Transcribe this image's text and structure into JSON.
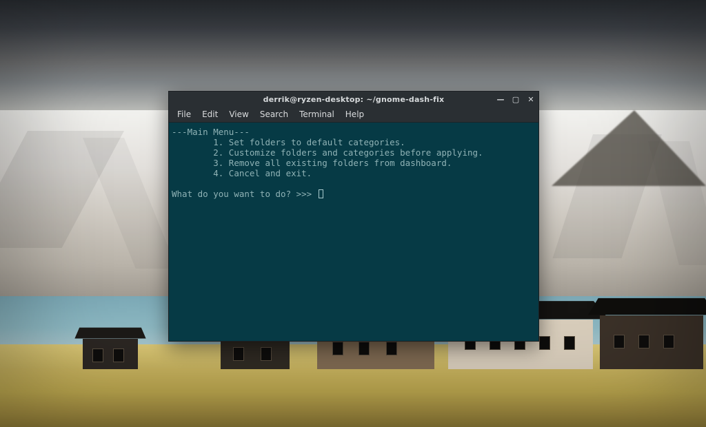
{
  "window": {
    "title": "derrik@ryzen-desktop: ~/gnome-dash-fix",
    "controls": {
      "minimize": "—",
      "maximize": "▢",
      "close": "✕"
    }
  },
  "menubar": {
    "items": [
      "File",
      "Edit",
      "View",
      "Search",
      "Terminal",
      "Help"
    ]
  },
  "terminal": {
    "menu_header": "---Main Menu---",
    "options": [
      "1. Set folders to default categories.",
      "2. Customize folders and categories before applying.",
      "3. Remove all existing folders from dashboard.",
      "4. Cancel and exit."
    ],
    "prompt": "What do you want to do? >>> "
  }
}
